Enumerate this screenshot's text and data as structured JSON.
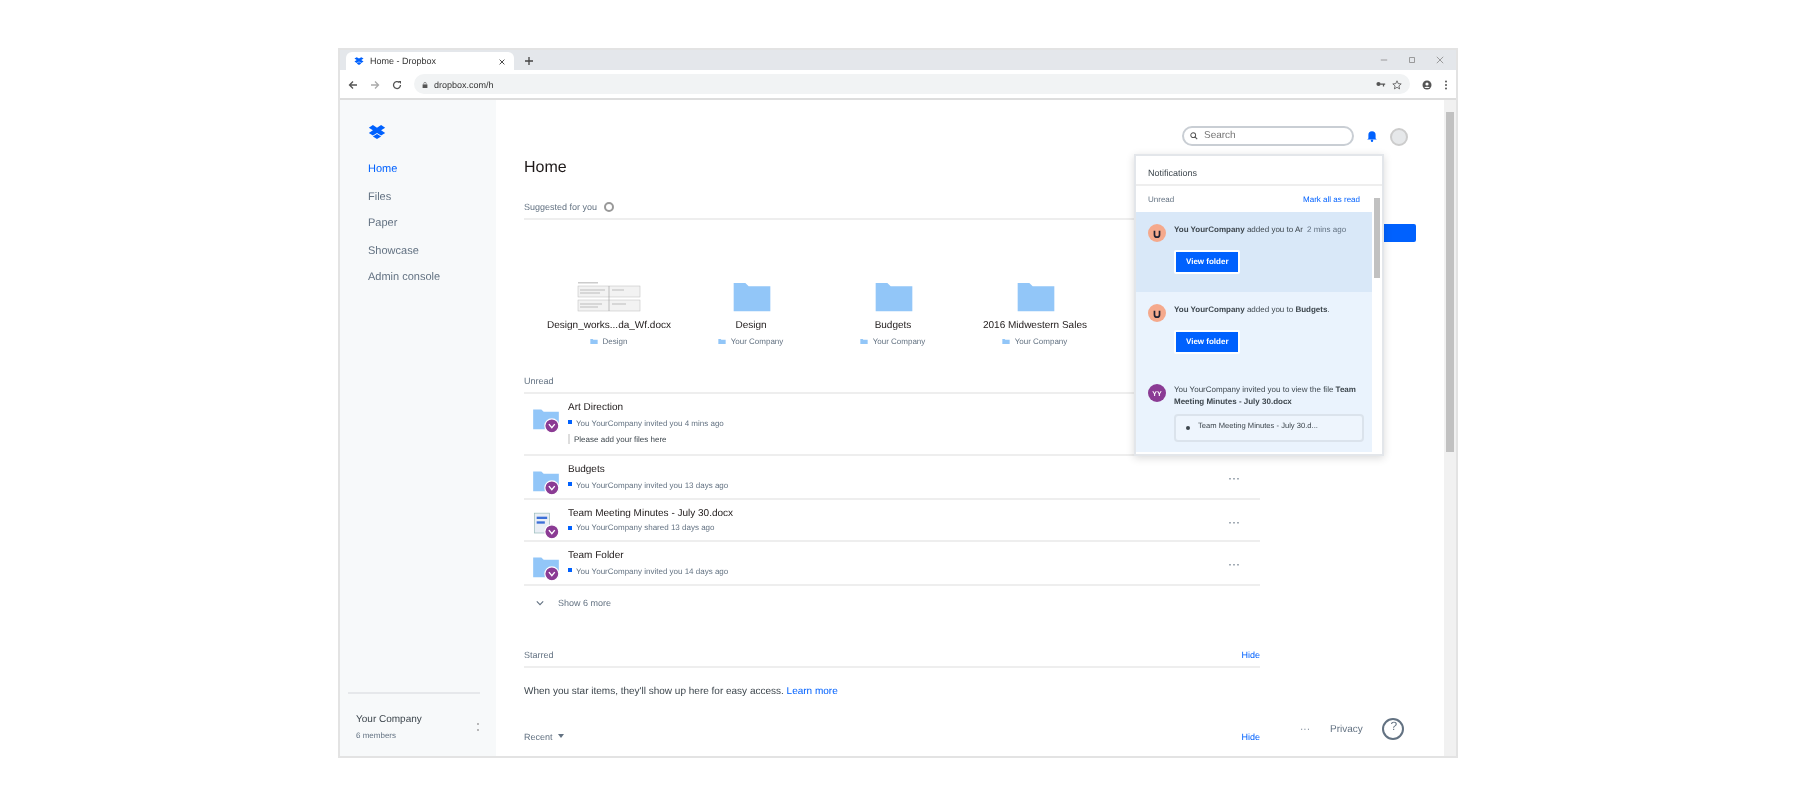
{
  "browser": {
    "tab_title": "Home - Dropbox",
    "url": "dropbox.com/h"
  },
  "sidebar": {
    "items": [
      {
        "label": "Home",
        "selected": true
      },
      {
        "label": "Files",
        "selected": false
      },
      {
        "label": "Paper",
        "selected": false
      },
      {
        "label": "Showcase",
        "selected": false
      },
      {
        "label": "Admin console",
        "selected": false
      }
    ],
    "team": {
      "name": "Your Company",
      "members": "6 members"
    }
  },
  "header": {
    "title": "Home",
    "search": {
      "placeholder": "Search"
    }
  },
  "suggested": {
    "title": "Suggested for you",
    "items": [
      {
        "kind": "document",
        "name": "Design_works...da_Wf.docx",
        "location": "Design"
      },
      {
        "kind": "folder",
        "name": "Design",
        "location": "Your Company"
      },
      {
        "kind": "folder",
        "name": "Budgets",
        "location": "Your Company"
      },
      {
        "kind": "folder",
        "name": "2016 Midwestern Sales",
        "location": "Your Company"
      }
    ]
  },
  "unread": {
    "title": "Unread",
    "items": [
      {
        "kind": "folder",
        "name": "Art Direction",
        "detail": "You YourCompany invited you 4 mins ago",
        "note": "Please add your files here"
      },
      {
        "kind": "folder",
        "name": "Budgets",
        "detail": "You YourCompany invited you 13 days ago",
        "menu": "···"
      },
      {
        "kind": "file",
        "name": "Team Meeting Minutes - July 30.docx",
        "detail": "You YourCompany shared 13 days ago",
        "menu": "···"
      },
      {
        "kind": "folder",
        "name": "Team Folder",
        "detail": "You YourCompany invited you 14 days ago",
        "menu": "···"
      }
    ],
    "more": "Show 6 more"
  },
  "starred": {
    "title": "Starred",
    "hide": "Hide",
    "text": "When you star items, they'll show up here for easy access.",
    "link": "Learn more"
  },
  "recent": {
    "title": "Recent",
    "hide": "Hide"
  },
  "footer": {
    "more": "···",
    "privacy": "Privacy",
    "help": "?"
  },
  "notifications": {
    "title": "Notifications",
    "tab": "Unread",
    "mark_all": "Mark all as read",
    "items": [
      {
        "kind": "company",
        "text": "**You YourCompany** added you to Ar",
        "time": "2 mins ago",
        "button": "View folder",
        "selected": true
      },
      {
        "kind": "company",
        "text": "**You YourCompany** added you to **Budgets**.",
        "button": "View folder",
        "selected": false
      },
      {
        "kind": "person",
        "initials": "YY",
        "text": "You YourCompany invited you to view the file **Team Meeting Minutes - July 30.docx**",
        "attachment": "Team Meeting Minutes - July 30.d...",
        "selected": false
      }
    ]
  }
}
